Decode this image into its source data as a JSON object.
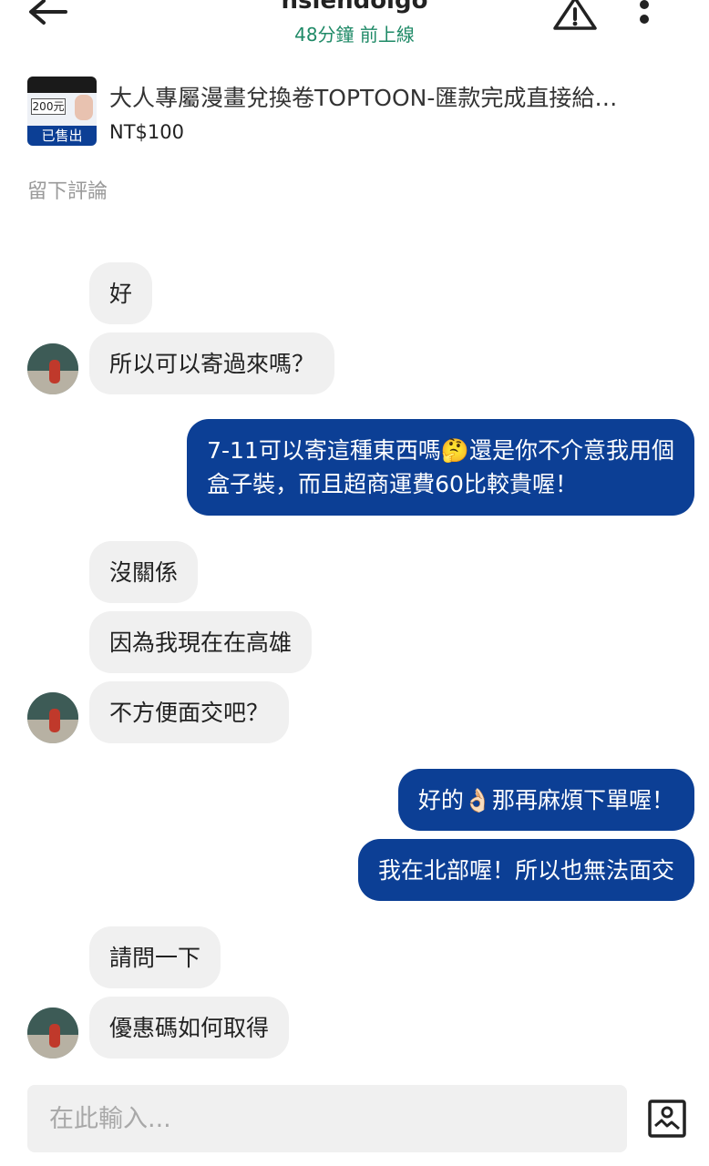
{
  "header": {
    "back_icon": "arrow-left-icon",
    "title": "hsiehdoigo",
    "status": "48分鐘 前上線",
    "report_icon": "warning-triangle-icon",
    "more_icon": "more-vertical-icon"
  },
  "listing": {
    "thumbnail_price_text": "200元",
    "sold_badge": "已售出",
    "title": "大人專屬漫畫兌換卷TOPTOON-匯款完成直接給…",
    "price": "NT$100"
  },
  "leave_review": "留下評論",
  "messages": [
    {
      "sender": "other",
      "text": "好"
    },
    {
      "sender": "other",
      "text": "所以可以寄過來嗎？"
    },
    {
      "sender": "me",
      "line1": "7-11可以寄這種東西嗎🤔還是你不介意我用個",
      "line2": "盒子裝，而且超商運費60比較貴喔！"
    },
    {
      "sender": "other",
      "text": "沒關係"
    },
    {
      "sender": "other",
      "text": "因為我現在在高雄"
    },
    {
      "sender": "other",
      "text": "不方便面交吧？"
    },
    {
      "sender": "me",
      "text": "好的👌🏻那再麻煩下單喔！"
    },
    {
      "sender": "me",
      "text": "我在北部喔！所以也無法面交"
    },
    {
      "sender": "other",
      "text": "請問一下"
    },
    {
      "sender": "other",
      "text": "優惠碼如何取得"
    }
  ],
  "composer": {
    "placeholder": "在此輸入...",
    "photo_icon": "image-upload-icon"
  },
  "colors": {
    "brand_blue": "#0c3f95",
    "online_green": "#1f8a67",
    "incoming_bubble": "#f0f0f0"
  }
}
